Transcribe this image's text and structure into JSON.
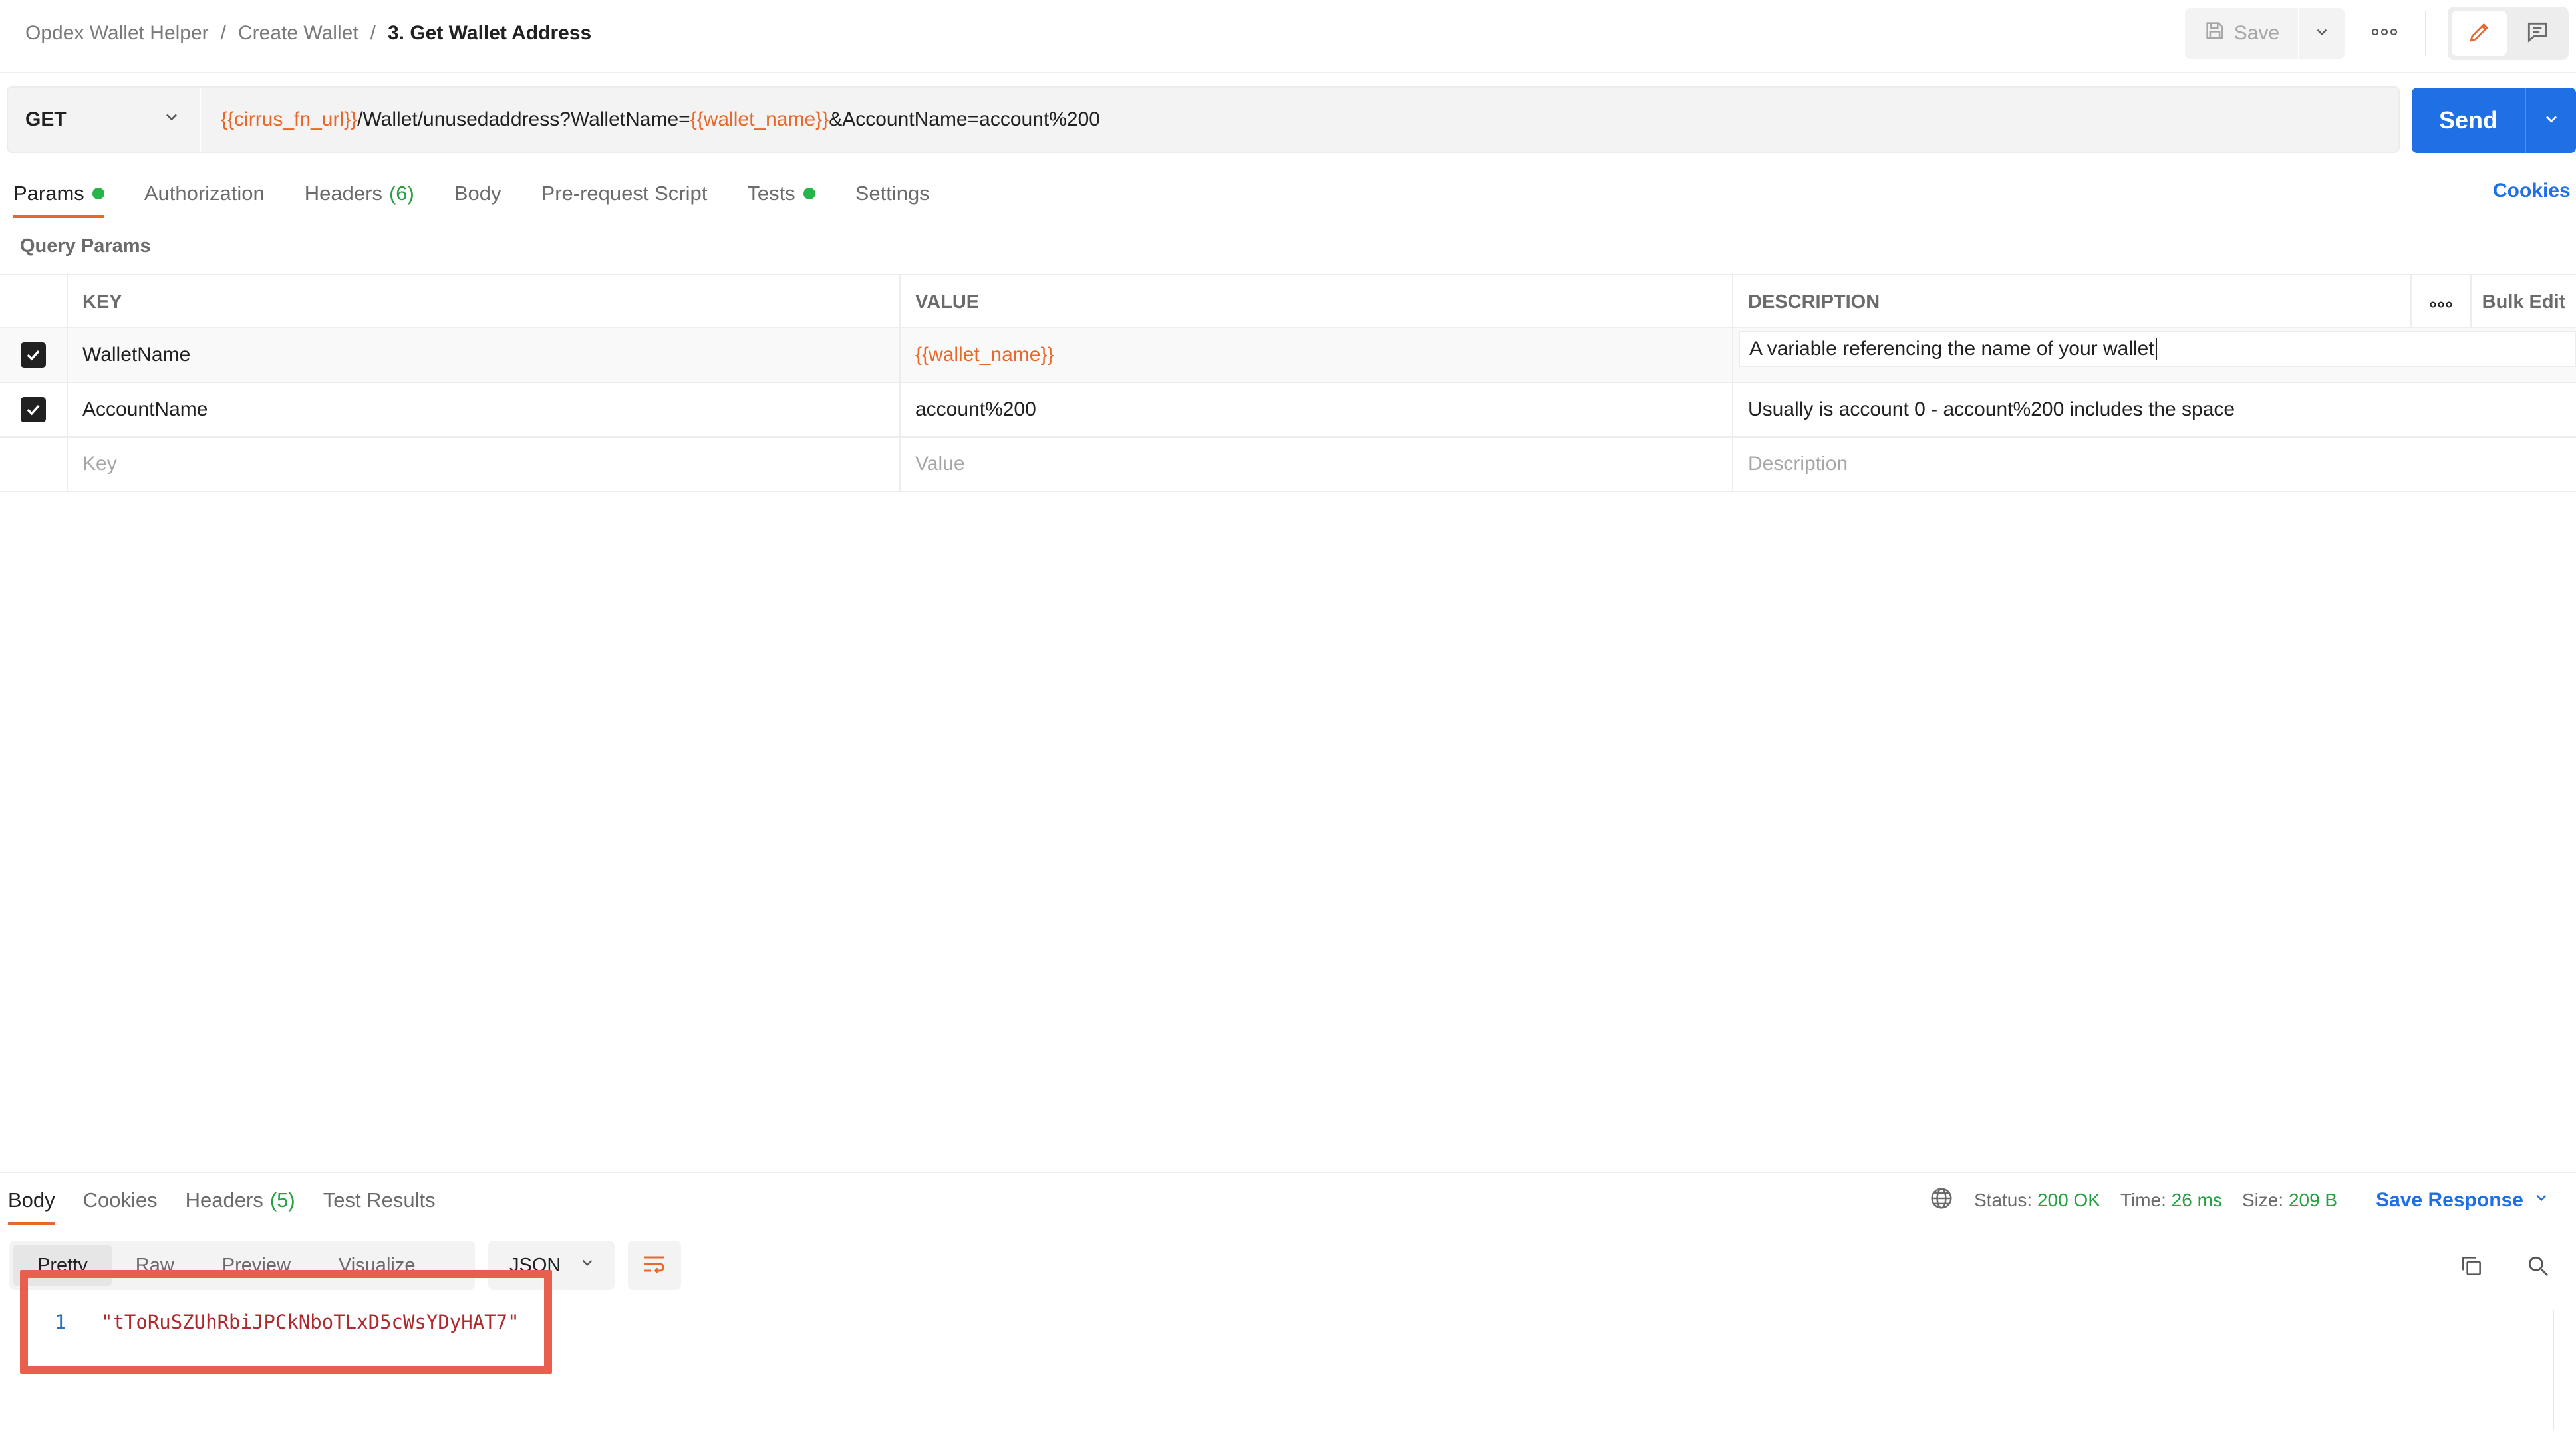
{
  "breadcrumb": {
    "items": [
      "Opdex Wallet Helper",
      "Create Wallet"
    ],
    "current": "3. Get Wallet Address",
    "separator": "/"
  },
  "toolbar": {
    "save_label": "Save"
  },
  "request": {
    "method": "GET",
    "url_parts": [
      {
        "text": "{{cirrus_fn_url}}",
        "variable": true
      },
      {
        "text": "/Wallet/unusedaddress?WalletName=",
        "variable": false
      },
      {
        "text": "{{wallet_name}}",
        "variable": true
      },
      {
        "text": "&AccountName=account%200",
        "variable": false
      }
    ],
    "send_label": "Send"
  },
  "request_tabs": {
    "params": "Params",
    "authorization": "Authorization",
    "headers": "Headers",
    "headers_count": "(6)",
    "body": "Body",
    "prerequest": "Pre-request Script",
    "tests": "Tests",
    "settings": "Settings",
    "cookies": "Cookies"
  },
  "query_params": {
    "label": "Query Params",
    "columns": {
      "key": "KEY",
      "value": "VALUE",
      "description": "DESCRIPTION",
      "bulk_edit": "Bulk Edit"
    },
    "rows": [
      {
        "checked": true,
        "key": "WalletName",
        "value": "{{wallet_name}}",
        "description": "A variable referencing the name of your wallet"
      },
      {
        "checked": true,
        "key": "AccountName",
        "value": "account%200",
        "description": "Usually is account 0 - account%200 includes the space"
      }
    ],
    "placeholders": {
      "key": "Key",
      "value": "Value",
      "description": "Description"
    }
  },
  "response_tabs": {
    "body": "Body",
    "cookies": "Cookies",
    "headers": "Headers",
    "headers_count": "(5)",
    "test_results": "Test Results"
  },
  "response_status": {
    "status_label": "Status:",
    "status_value": "200 OK",
    "time_label": "Time:",
    "time_value": "26 ms",
    "size_label": "Size:",
    "size_value": "209 B",
    "save_response": "Save Response"
  },
  "response_format": {
    "options": [
      "Pretty",
      "Raw",
      "Preview",
      "Visualize"
    ],
    "selected": "JSON"
  },
  "response_body": {
    "line_number": "1",
    "value": "\"tToRuSZUhRbiJPCkNboTLxD5cWsYDyHAT7\""
  },
  "colors": {
    "accent_orange": "#e8672a",
    "send_blue": "#1f6fe5",
    "status_green": "#26a043",
    "highlight_red": "#e8604d"
  }
}
